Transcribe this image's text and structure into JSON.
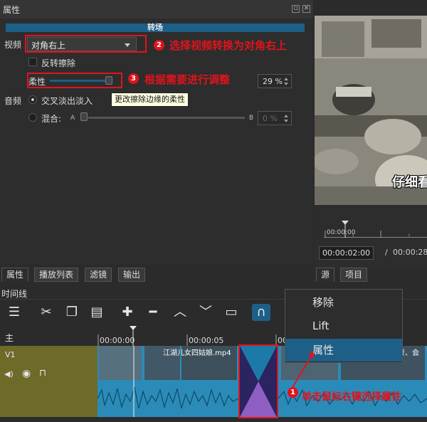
{
  "panel": {
    "title": "属性",
    "float_btn": "▫",
    "close_btn": "✕"
  },
  "properties": {
    "section_header": "转场",
    "video_label": "视频",
    "video_value": "对角右上",
    "invert_label": "反转擦除",
    "softness_label": "柔性",
    "softness_value": "29 %",
    "softness_fraction": 0.29,
    "audio_label": "音频",
    "crossfade_label": "交叉淡出淡入",
    "mix_label": "混合:",
    "mix_a": "A",
    "mix_b": "B",
    "mix_value": "0 %",
    "tooltip": "更改擦除边缘的柔性"
  },
  "annotations": {
    "a1_num": "1",
    "a1_text": "单击鼠标右键选择属性",
    "a2_num": "2",
    "a2_text": "选择视频转换为对角右上",
    "a3_num": "3",
    "a3_text": "根据需要进行调整"
  },
  "player": {
    "subtitle": "仔细看",
    "ruler_start": "00:00:00",
    "position": "00:00:02:00",
    "separator": "/",
    "duration": "00:00:28"
  },
  "tabs_left": [
    "属性",
    "播放列表",
    "滤镜",
    "输出"
  ],
  "tabs_right": [
    "源",
    "项目"
  ],
  "timeline": {
    "label": "时间线",
    "master_label": "主",
    "track_label": "V1",
    "ticks": [
      "00:00:00",
      "00:00:05",
      "00:00:10"
    ],
    "clip1_name": "江湖儿女四姑娘.mp4",
    "clip2_name": "景、会"
  },
  "context_menu": {
    "items": [
      "移除",
      "Lift",
      "属性"
    ]
  },
  "colors": {
    "accent": "#1d5f87",
    "annotation": "#e0141c",
    "clip": "#2b8bb8",
    "track_head": "#6d6a2a"
  },
  "icons": {
    "menu": "hamburger-icon",
    "cut": "scissors-icon",
    "copy": "copy-icon",
    "paste": "clipboard-icon",
    "add": "plus-icon",
    "remove": "minus-icon",
    "lift": "chevron-up-icon",
    "overwrite": "chevron-down-icon",
    "split": "split-icon",
    "snap": "magnet-icon"
  }
}
